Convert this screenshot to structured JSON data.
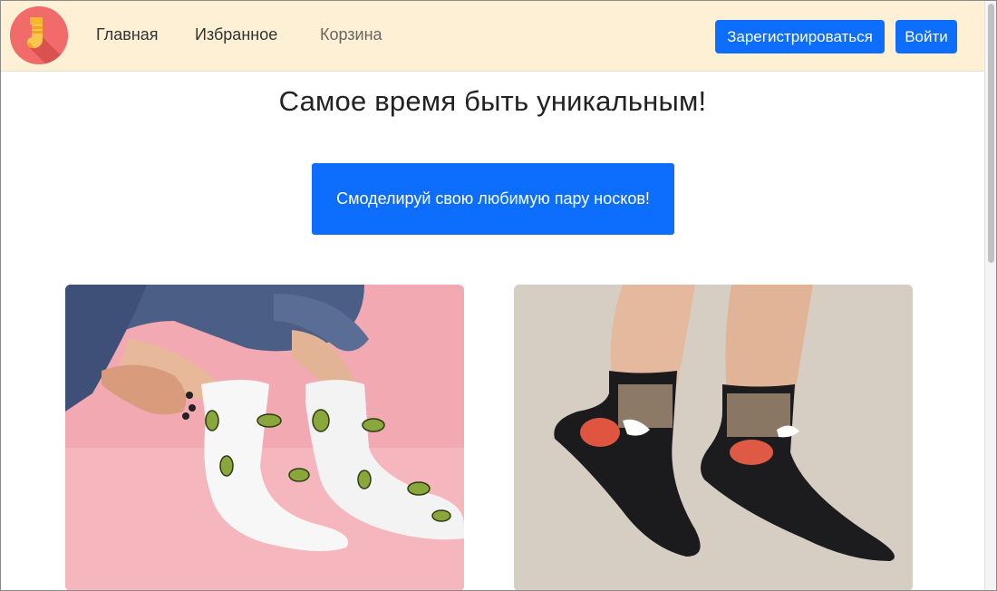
{
  "nav": {
    "logo_icon": "sock-icon",
    "links": [
      {
        "label": "Главная"
      },
      {
        "label": "Избранное"
      },
      {
        "label": "Корзина"
      }
    ],
    "register_label": "Зарегистрироваться",
    "login_label": "Войти"
  },
  "hero": {
    "title": "Самое время быть уникальным!",
    "cta_label": "Смоделируй свою любимую пару носков!"
  },
  "colors": {
    "navbar_bg": "#fdf0d5",
    "accent": "#0d6efd",
    "logo_bg": "#f26b6b"
  },
  "gallery": [
    {
      "image": "white-avocado-socks-photo"
    },
    {
      "image": "black-cat-socks-photo"
    }
  ]
}
